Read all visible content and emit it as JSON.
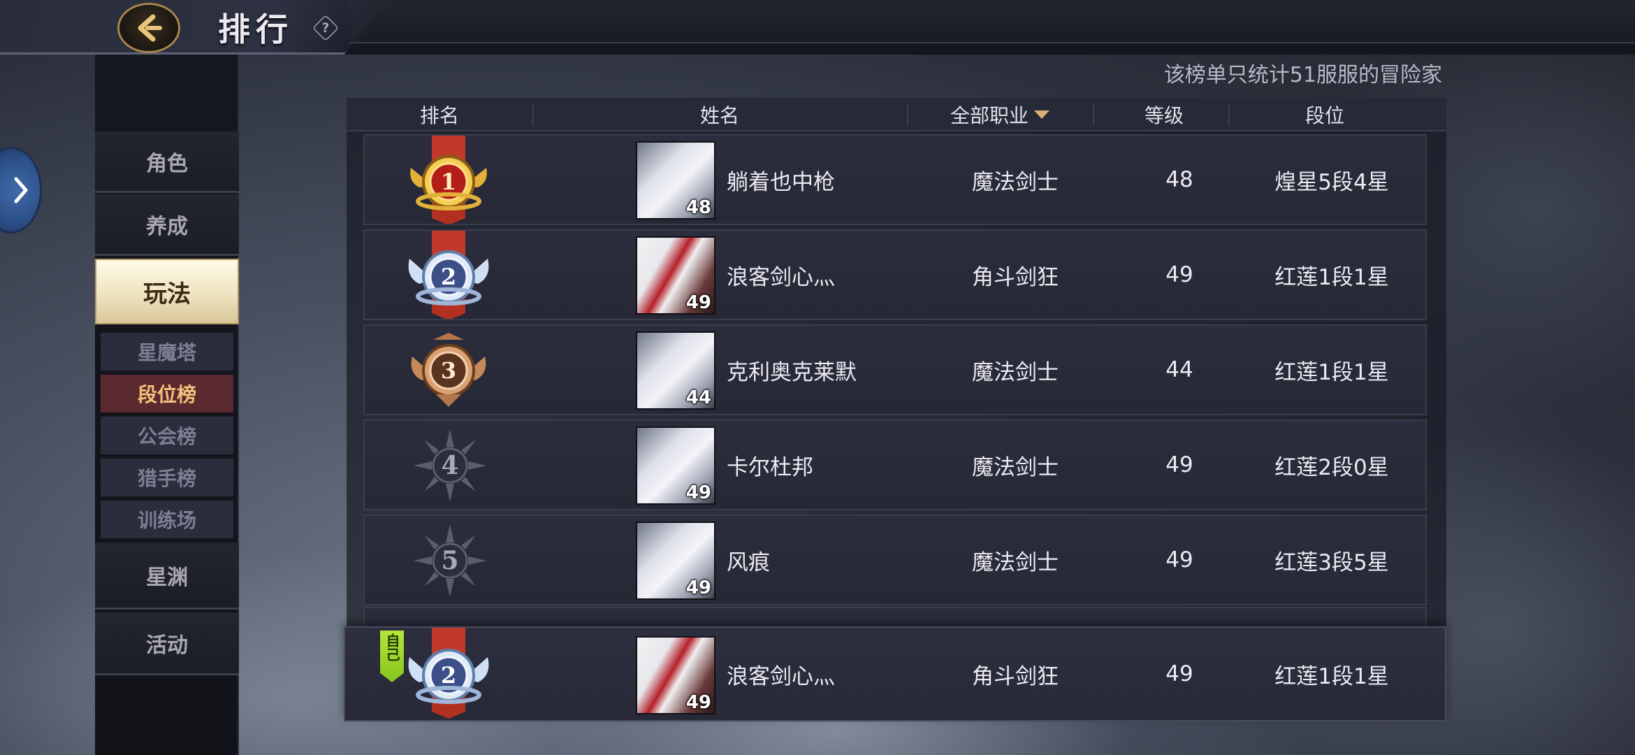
{
  "header": {
    "title": "排行",
    "help_icon_text": "?"
  },
  "sidebar": {
    "items": [
      {
        "label": "角色"
      },
      {
        "label": "养成"
      },
      {
        "label": "玩法"
      },
      {
        "label": "星渊"
      },
      {
        "label": "活动"
      }
    ],
    "active_item": "玩法",
    "sub_items": [
      {
        "label": "星魔塔"
      },
      {
        "label": "段位榜"
      },
      {
        "label": "公会榜"
      },
      {
        "label": "猎手榜"
      },
      {
        "label": "训练场"
      }
    ],
    "active_sub_item": "段位榜"
  },
  "notice": "该榜单只统计51服服的冒险家",
  "table": {
    "headers": {
      "rank": "排名",
      "name": "姓名",
      "class_filter": "全部职业",
      "level": "等级",
      "tier": "段位"
    },
    "rows": [
      {
        "rank": "1",
        "name": "躺着也中枪",
        "class": "魔法剑士",
        "level": "48",
        "tier": "煌星5段4星",
        "avatar_level": "48",
        "medal": "gold"
      },
      {
        "rank": "2",
        "name": "浪客剑心灬",
        "class": "角斗剑狂",
        "level": "49",
        "tier": "红莲1段1星",
        "avatar_level": "49",
        "medal": "silver"
      },
      {
        "rank": "3",
        "name": "克利奥克莱默",
        "class": "魔法剑士",
        "level": "44",
        "tier": "红莲1段1星",
        "avatar_level": "44",
        "medal": "bronze"
      },
      {
        "rank": "4",
        "name": "卡尔杜邦",
        "class": "魔法剑士",
        "level": "49",
        "tier": "红莲2段0星",
        "avatar_level": "49",
        "medal": "gray"
      },
      {
        "rank": "5",
        "name": "风痕",
        "class": "魔法剑士",
        "level": "49",
        "tier": "红莲3段5星",
        "avatar_level": "49",
        "medal": "gray"
      }
    ],
    "self_row": {
      "tag": "自己",
      "rank": "2",
      "name": "浪客剑心灬",
      "class": "角斗剑狂",
      "level": "49",
      "tier": "红莲1段1星",
      "avatar_level": "49",
      "medal": "silver"
    }
  },
  "colors": {
    "gold": "#e3b13a",
    "silver": "#9fb6d8",
    "bronze": "#b2774a",
    "ribbon_red": "#c0392b",
    "self_tag_green": "#9ad52a"
  }
}
